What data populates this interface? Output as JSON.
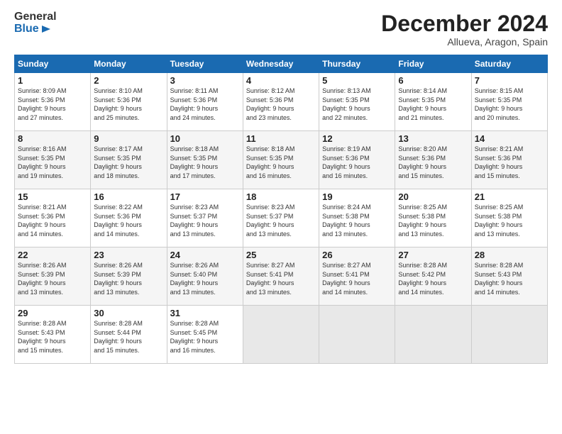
{
  "logo": {
    "line1": "General",
    "line2": "Blue"
  },
  "title": "December 2024",
  "location": "Allueva, Aragon, Spain",
  "days_of_week": [
    "Sunday",
    "Monday",
    "Tuesday",
    "Wednesday",
    "Thursday",
    "Friday",
    "Saturday"
  ],
  "weeks": [
    [
      {
        "num": "1",
        "info": "Sunrise: 8:09 AM\nSunset: 5:36 PM\nDaylight: 9 hours\nand 27 minutes."
      },
      {
        "num": "2",
        "info": "Sunrise: 8:10 AM\nSunset: 5:36 PM\nDaylight: 9 hours\nand 25 minutes."
      },
      {
        "num": "3",
        "info": "Sunrise: 8:11 AM\nSunset: 5:36 PM\nDaylight: 9 hours\nand 24 minutes."
      },
      {
        "num": "4",
        "info": "Sunrise: 8:12 AM\nSunset: 5:36 PM\nDaylight: 9 hours\nand 23 minutes."
      },
      {
        "num": "5",
        "info": "Sunrise: 8:13 AM\nSunset: 5:35 PM\nDaylight: 9 hours\nand 22 minutes."
      },
      {
        "num": "6",
        "info": "Sunrise: 8:14 AM\nSunset: 5:35 PM\nDaylight: 9 hours\nand 21 minutes."
      },
      {
        "num": "7",
        "info": "Sunrise: 8:15 AM\nSunset: 5:35 PM\nDaylight: 9 hours\nand 20 minutes."
      }
    ],
    [
      {
        "num": "8",
        "info": "Sunrise: 8:16 AM\nSunset: 5:35 PM\nDaylight: 9 hours\nand 19 minutes."
      },
      {
        "num": "9",
        "info": "Sunrise: 8:17 AM\nSunset: 5:35 PM\nDaylight: 9 hours\nand 18 minutes."
      },
      {
        "num": "10",
        "info": "Sunrise: 8:18 AM\nSunset: 5:35 PM\nDaylight: 9 hours\nand 17 minutes."
      },
      {
        "num": "11",
        "info": "Sunrise: 8:18 AM\nSunset: 5:35 PM\nDaylight: 9 hours\nand 16 minutes."
      },
      {
        "num": "12",
        "info": "Sunrise: 8:19 AM\nSunset: 5:36 PM\nDaylight: 9 hours\nand 16 minutes."
      },
      {
        "num": "13",
        "info": "Sunrise: 8:20 AM\nSunset: 5:36 PM\nDaylight: 9 hours\nand 15 minutes."
      },
      {
        "num": "14",
        "info": "Sunrise: 8:21 AM\nSunset: 5:36 PM\nDaylight: 9 hours\nand 15 minutes."
      }
    ],
    [
      {
        "num": "15",
        "info": "Sunrise: 8:21 AM\nSunset: 5:36 PM\nDaylight: 9 hours\nand 14 minutes."
      },
      {
        "num": "16",
        "info": "Sunrise: 8:22 AM\nSunset: 5:36 PM\nDaylight: 9 hours\nand 14 minutes."
      },
      {
        "num": "17",
        "info": "Sunrise: 8:23 AM\nSunset: 5:37 PM\nDaylight: 9 hours\nand 13 minutes."
      },
      {
        "num": "18",
        "info": "Sunrise: 8:23 AM\nSunset: 5:37 PM\nDaylight: 9 hours\nand 13 minutes."
      },
      {
        "num": "19",
        "info": "Sunrise: 8:24 AM\nSunset: 5:38 PM\nDaylight: 9 hours\nand 13 minutes."
      },
      {
        "num": "20",
        "info": "Sunrise: 8:25 AM\nSunset: 5:38 PM\nDaylight: 9 hours\nand 13 minutes."
      },
      {
        "num": "21",
        "info": "Sunrise: 8:25 AM\nSunset: 5:38 PM\nDaylight: 9 hours\nand 13 minutes."
      }
    ],
    [
      {
        "num": "22",
        "info": "Sunrise: 8:26 AM\nSunset: 5:39 PM\nDaylight: 9 hours\nand 13 minutes."
      },
      {
        "num": "23",
        "info": "Sunrise: 8:26 AM\nSunset: 5:39 PM\nDaylight: 9 hours\nand 13 minutes."
      },
      {
        "num": "24",
        "info": "Sunrise: 8:26 AM\nSunset: 5:40 PM\nDaylight: 9 hours\nand 13 minutes."
      },
      {
        "num": "25",
        "info": "Sunrise: 8:27 AM\nSunset: 5:41 PM\nDaylight: 9 hours\nand 13 minutes."
      },
      {
        "num": "26",
        "info": "Sunrise: 8:27 AM\nSunset: 5:41 PM\nDaylight: 9 hours\nand 14 minutes."
      },
      {
        "num": "27",
        "info": "Sunrise: 8:28 AM\nSunset: 5:42 PM\nDaylight: 9 hours\nand 14 minutes."
      },
      {
        "num": "28",
        "info": "Sunrise: 8:28 AM\nSunset: 5:43 PM\nDaylight: 9 hours\nand 14 minutes."
      }
    ],
    [
      {
        "num": "29",
        "info": "Sunrise: 8:28 AM\nSunset: 5:43 PM\nDaylight: 9 hours\nand 15 minutes."
      },
      {
        "num": "30",
        "info": "Sunrise: 8:28 AM\nSunset: 5:44 PM\nDaylight: 9 hours\nand 15 minutes."
      },
      {
        "num": "31",
        "info": "Sunrise: 8:28 AM\nSunset: 5:45 PM\nDaylight: 9 hours\nand 16 minutes."
      },
      {
        "num": "",
        "info": ""
      },
      {
        "num": "",
        "info": ""
      },
      {
        "num": "",
        "info": ""
      },
      {
        "num": "",
        "info": ""
      }
    ]
  ]
}
